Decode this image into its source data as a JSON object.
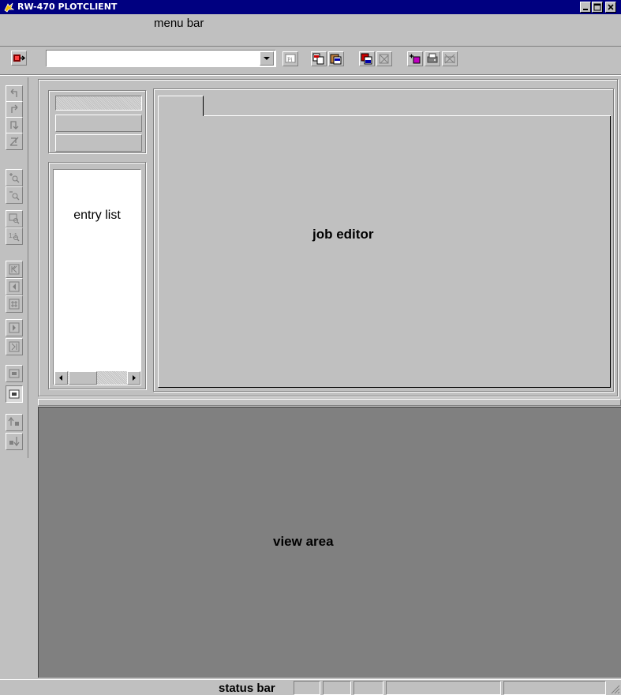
{
  "window": {
    "title": "RW-470 PLOTCLIENT",
    "controls": [
      "minimize-icon",
      "maximize-icon",
      "close-icon"
    ]
  },
  "menubar": {
    "label": "menu bar"
  },
  "toolbar": {
    "combo_value": "",
    "buttons": [
      "exit-icon",
      "properties-icon",
      "copy-icon",
      "paste-icon",
      "save-icon",
      "delete-icon",
      "add-entry-icon",
      "print-icon",
      "cancel-print-icon"
    ]
  },
  "sidebar_tools": [
    "undo-icon",
    "redo-icon",
    "rotate-icon",
    "mirror-icon",
    "zoom-in-icon",
    "zoom-out-icon",
    "zoom-window-icon",
    "zoom-fit-icon",
    "first-page-icon",
    "previous-page-icon",
    "page-grid-icon",
    "next-page-icon",
    "last-page-icon",
    "view-normal-icon",
    "view-full-icon",
    "move-up-icon",
    "move-down-icon"
  ],
  "panels": {
    "entry_list": {
      "label": "entry list"
    },
    "job_editor": {
      "label": "job editor"
    },
    "view_area": {
      "label": "view area"
    }
  },
  "statusbar": {
    "label": "status bar"
  },
  "colors": {
    "titlebar": "#000080",
    "face": "#c0c0c0",
    "view_area": "#808080",
    "list_bg": "#ffffff"
  }
}
